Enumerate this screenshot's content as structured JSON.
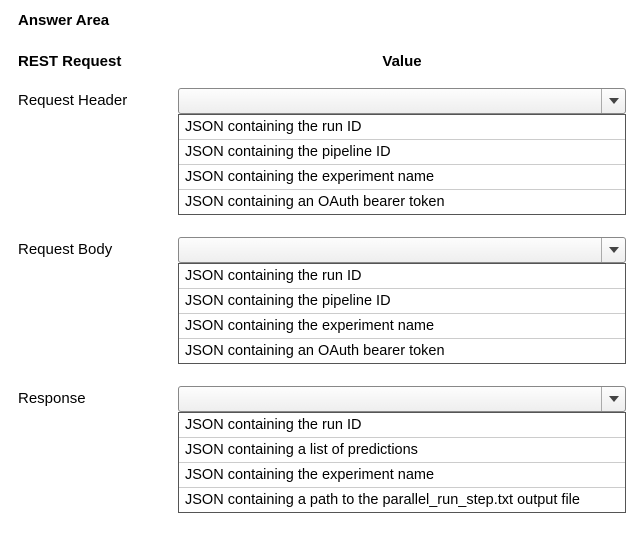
{
  "title": "Answer Area",
  "columns": {
    "left": "REST Request",
    "right": "Value"
  },
  "sections": {
    "requestHeader": {
      "label": "Request Header",
      "options": [
        "JSON containing the run ID",
        "JSON containing the pipeline ID",
        "JSON containing the experiment name",
        "JSON containing an OAuth bearer token"
      ]
    },
    "requestBody": {
      "label": "Request Body",
      "options": [
        "JSON containing the run ID",
        "JSON containing the pipeline ID",
        "JSON containing the experiment name",
        "JSON containing an OAuth bearer token"
      ]
    },
    "response": {
      "label": "Response",
      "options": [
        "JSON containing the run ID",
        "JSON containing a list of predictions",
        "JSON containing the experiment name",
        "JSON containing a path to the parallel_run_step.txt output file"
      ]
    }
  }
}
